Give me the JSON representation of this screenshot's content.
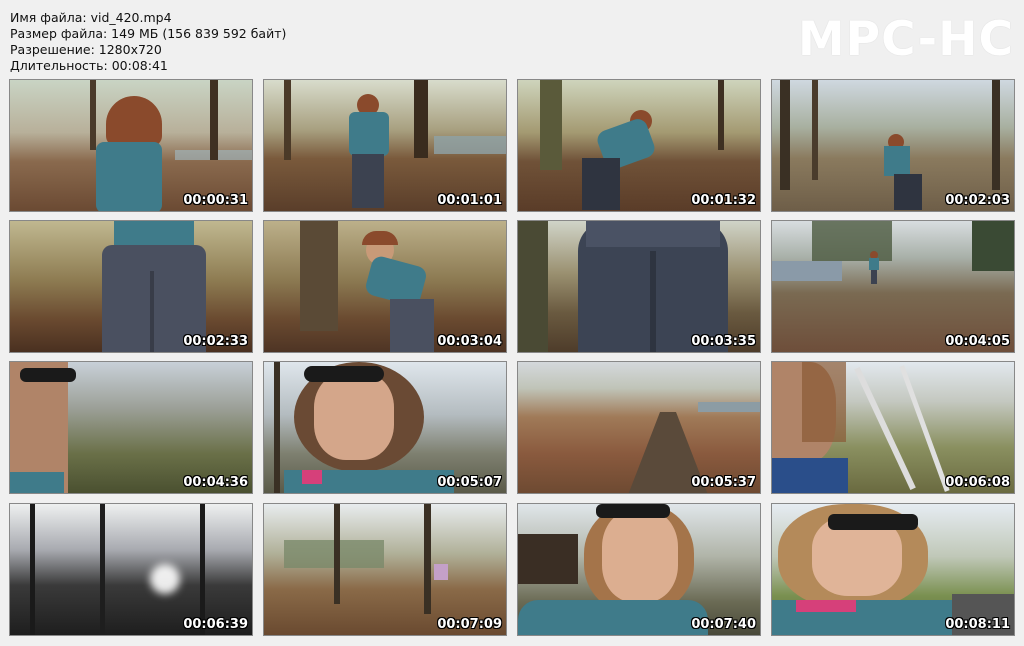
{
  "file_info": {
    "name_line": "Имя файла: vid_420.mp4",
    "size_line": "Размер файла: 149 МБ (156 839 592 байт)",
    "resolution_line": "Разрешение: 1280x720",
    "duration_line": "Длительность: 00:08:41"
  },
  "brand": "MPC-HC",
  "thumbnails": [
    {
      "time": "00:00:31",
      "scene": "forest-path-back"
    },
    {
      "time": "00:01:01",
      "scene": "river-path-back"
    },
    {
      "time": "00:01:32",
      "scene": "bending-forest"
    },
    {
      "time": "00:02:03",
      "scene": "trail-far"
    },
    {
      "time": "00:02:33",
      "scene": "jeans-closeup"
    },
    {
      "time": "00:03:04",
      "scene": "bending-sunglasses"
    },
    {
      "time": "00:03:35",
      "scene": "jeans-closeup-2"
    },
    {
      "time": "00:04:05",
      "scene": "path-distant"
    },
    {
      "time": "00:04:36",
      "scene": "selfie-trees"
    },
    {
      "time": "00:05:07",
      "scene": "low-angle-face"
    },
    {
      "time": "00:05:37",
      "scene": "open-field"
    },
    {
      "time": "00:06:08",
      "scene": "low-angle-trees"
    },
    {
      "time": "00:06:39",
      "scene": "silhouette-trees"
    },
    {
      "time": "00:07:09",
      "scene": "sunny-park"
    },
    {
      "time": "00:07:40",
      "scene": "face-close"
    },
    {
      "time": "00:08:11",
      "scene": "face-road"
    }
  ]
}
